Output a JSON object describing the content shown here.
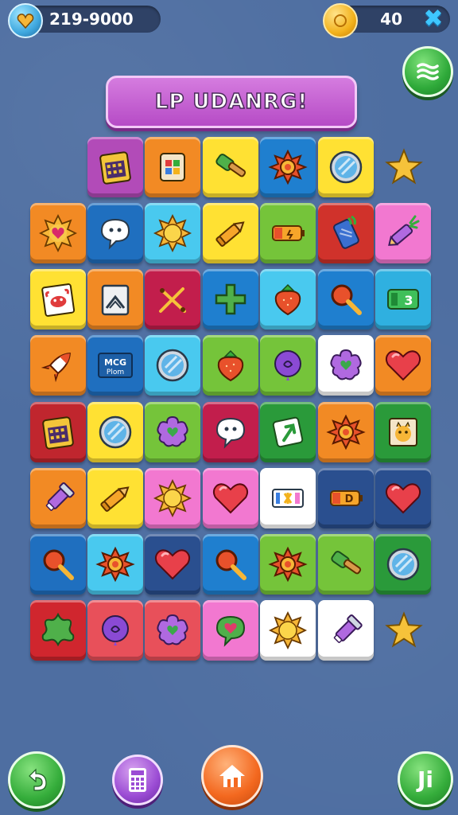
{
  "hud": {
    "gems_value": "219-9000",
    "coins_value": "40",
    "close_glyph": "✖"
  },
  "banner": {
    "title": "LP UDANRG!"
  },
  "tiles": [
    {
      "icon": "calendar-icon"
    },
    {
      "icon": "gift-box-icon"
    },
    {
      "icon": "hammer-icon"
    },
    {
      "icon": "sun-gear-icon"
    },
    {
      "icon": "mirror-icon"
    },
    {
      "icon": "sun-heart-icon"
    },
    {
      "icon": "speech-bubble-icon"
    },
    {
      "icon": "sun-icon"
    },
    {
      "icon": "crayon-icon"
    },
    {
      "icon": "battery-icon"
    },
    {
      "icon": "drink-can-icon"
    },
    {
      "icon": "pencil-plant-icon"
    },
    {
      "icon": "crab-card-icon"
    },
    {
      "icon": "picture-card-icon"
    },
    {
      "icon": "scissors-icon"
    },
    {
      "icon": "plus-icon"
    },
    {
      "icon": "strawberry-icon"
    },
    {
      "icon": "magnifier-icon"
    },
    {
      "icon": "number-card-icon",
      "text": "3"
    },
    {
      "icon": "rocket-icon"
    },
    {
      "icon": "text-card-icon",
      "text": "MCG Plom"
    },
    {
      "icon": "mirror-icon"
    },
    {
      "icon": "strawberry-icon"
    },
    {
      "icon": "balloon-icon"
    },
    {
      "icon": "flower-heart-icon"
    },
    {
      "icon": "heart-icon"
    },
    {
      "icon": "calendar-icon"
    },
    {
      "icon": "mirror-icon"
    },
    {
      "icon": "flower-heart-icon"
    },
    {
      "icon": "speech-bubble-icon"
    },
    {
      "icon": "arrow-card-icon"
    },
    {
      "icon": "sun-gear-icon"
    },
    {
      "icon": "animal-card-icon"
    },
    {
      "icon": "flashlight-icon"
    },
    {
      "icon": "crayon-icon"
    },
    {
      "icon": "sun-icon"
    },
    {
      "icon": "heart-icon"
    },
    {
      "icon": "ticket-icon"
    },
    {
      "icon": "battery-icon",
      "text": "D"
    },
    {
      "icon": "heart-icon"
    },
    {
      "icon": "magnifier-icon"
    },
    {
      "icon": "sun-gear-icon"
    },
    {
      "icon": "heart-icon"
    },
    {
      "icon": "magnifier-icon"
    },
    {
      "icon": "sun-gear-icon"
    },
    {
      "icon": "hammer-icon"
    },
    {
      "icon": "mirror-icon"
    },
    {
      "icon": "star-blob-icon"
    },
    {
      "icon": "balloon-icon"
    },
    {
      "icon": "flower-heart-icon"
    },
    {
      "icon": "balloon-heart-icon"
    },
    {
      "icon": "sun-icon"
    },
    {
      "icon": "flashlight-icon"
    }
  ],
  "loose_stars": [
    {
      "icon": "star-icon"
    },
    {
      "icon": "star-icon"
    }
  ],
  "bottom": {
    "undo_icon": "undo-icon",
    "calc_icon": "calculator-icon",
    "home_icon": "home-icon",
    "right_label": "Ji"
  },
  "colors": {
    "background": "#4e6ea1",
    "banner": "#c35ad1",
    "accent_green": "#35ad3b",
    "accent_orange": "#f3681f"
  }
}
